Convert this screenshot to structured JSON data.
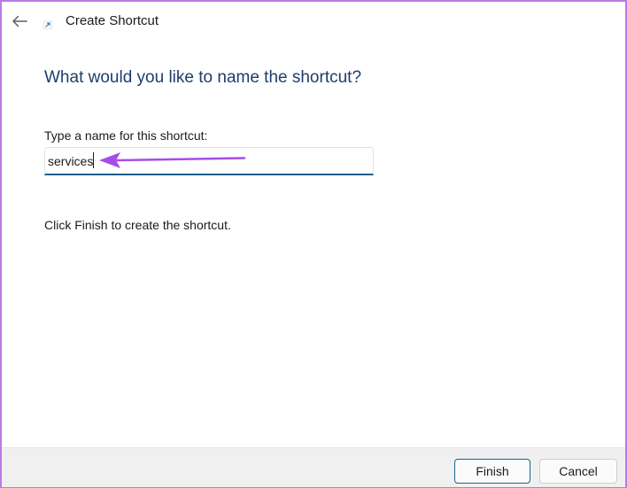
{
  "window": {
    "title": "Create Shortcut",
    "back_icon": "arrow-left-icon",
    "app_icon": "shortcut-arrow-icon"
  },
  "main": {
    "heading": "What would you like to name the shortcut?",
    "field_label": "Type a name for this shortcut:",
    "name_value": "services",
    "hint": "Click Finish to create the shortcut."
  },
  "footer": {
    "finish_label": "Finish",
    "cancel_label": "Cancel"
  },
  "colors": {
    "accent": "#1a5f8a",
    "heading": "#1e3c6e",
    "annotation": "#a64de8",
    "frame": "#b97ae6"
  }
}
